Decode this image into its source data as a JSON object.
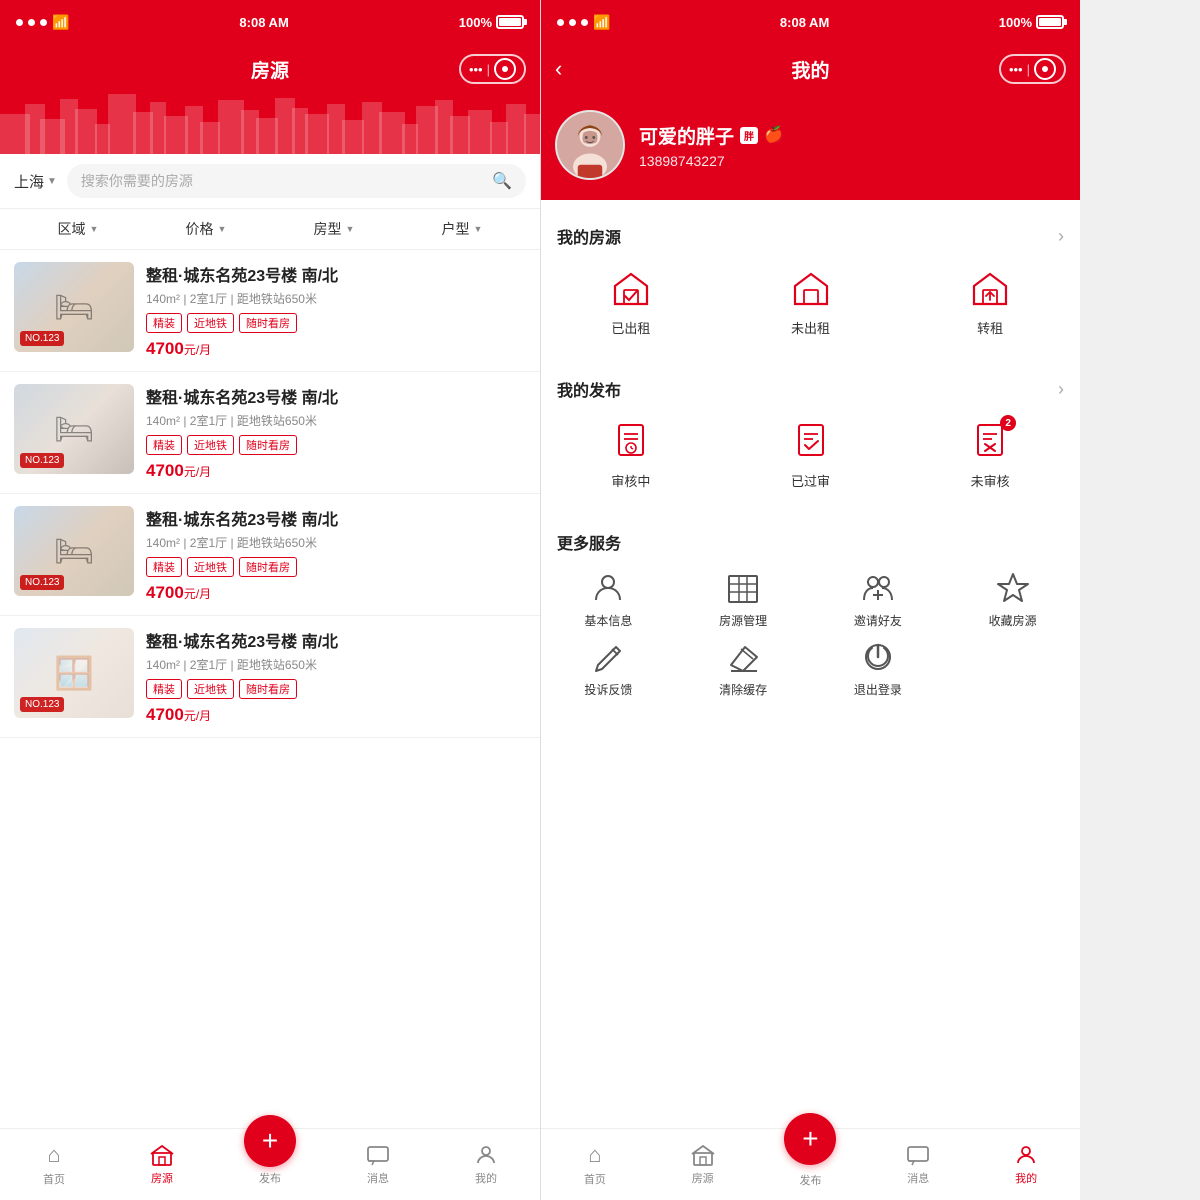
{
  "phones": [
    {
      "id": "left",
      "statusBar": {
        "time": "8:08 AM",
        "battery": "100%"
      },
      "header": {
        "title": "房源",
        "hasBack": false
      },
      "search": {
        "city": "上海",
        "placeholder": "搜索你需要的房源"
      },
      "filters": [
        {
          "label": "区域"
        },
        {
          "label": "价格"
        },
        {
          "label": "房型"
        },
        {
          "label": "户型"
        }
      ],
      "listings": [
        {
          "title": "整租·城东名苑23号楼  南/北",
          "meta": "140m² | 2室1厅 | 距地铁站650米",
          "tags": [
            "精装",
            "近地铁",
            "随时看房"
          ],
          "price": "4700",
          "unit": "元/月",
          "badge": "NO.123",
          "imgClass": "room-img-1",
          "imgIcon": "🛏"
        },
        {
          "title": "整租·城东名苑23号楼  南/北",
          "meta": "140m² | 2室1厅 | 距地铁站650米",
          "tags": [
            "精装",
            "近地铁",
            "随时看房"
          ],
          "price": "4700",
          "unit": "元/月",
          "badge": "NO.123",
          "imgClass": "room-img-2",
          "imgIcon": "🛏"
        },
        {
          "title": "整租·城东名苑23号楼  南/北",
          "meta": "140m² | 2室1厅 | 距地铁站650米",
          "tags": [
            "精装",
            "近地铁",
            "随时看房"
          ],
          "price": "4700",
          "unit": "元/月",
          "badge": "NO.123",
          "imgClass": "room-img-3",
          "imgIcon": "🛏"
        },
        {
          "title": "整租·城东名苑23号楼  南/北",
          "meta": "140m² | 2室1厅 | 距地铁站650米",
          "tags": [
            "精装",
            "近地铁",
            "随时看房"
          ],
          "price": "4700",
          "unit": "元/月",
          "badge": "NO.123",
          "imgClass": "room-img-4",
          "imgIcon": "🪟"
        }
      ],
      "nav": [
        {
          "label": "首页",
          "icon": "⌂",
          "active": false
        },
        {
          "label": "房源",
          "icon": "🏛",
          "active": true
        },
        {
          "label": "发布",
          "icon": "+",
          "isPlus": true
        },
        {
          "label": "消息",
          "icon": "💬",
          "active": false
        },
        {
          "label": "我的",
          "icon": "👤",
          "active": false
        }
      ]
    },
    {
      "id": "right",
      "statusBar": {
        "time": "8:08 AM",
        "battery": "100%"
      },
      "header": {
        "title": "我的",
        "hasBack": true
      },
      "profile": {
        "name": "可爱的胖子",
        "badge": "胖",
        "phone": "13898743227",
        "avatarEmoji": "👩"
      },
      "myListings": {
        "title": "我的房源",
        "items": [
          {
            "label": "已出租",
            "icon": "house-check"
          },
          {
            "label": "未出租",
            "icon": "house-empty"
          },
          {
            "label": "转租",
            "icon": "house-transfer"
          }
        ]
      },
      "myPublish": {
        "title": "我的发布",
        "items": [
          {
            "label": "审核中",
            "icon": "clock-check",
            "badge": null
          },
          {
            "label": "已过审",
            "icon": "doc-check",
            "badge": null
          },
          {
            "label": "未审核",
            "icon": "doc-x",
            "badge": "2"
          }
        ]
      },
      "moreServices": {
        "title": "更多服务",
        "items": [
          {
            "label": "基本信息",
            "icon": "person-icon"
          },
          {
            "label": "房源管理",
            "icon": "building-icon"
          },
          {
            "label": "邀请好友",
            "icon": "invite-icon"
          },
          {
            "label": "收藏房源",
            "icon": "star-icon"
          },
          {
            "label": "投诉反馈",
            "icon": "edit-icon"
          },
          {
            "label": "清除缓存",
            "icon": "eraser-icon"
          },
          {
            "label": "退出登录",
            "icon": "power-icon"
          }
        ]
      },
      "nav": [
        {
          "label": "首页",
          "icon": "⌂",
          "active": false
        },
        {
          "label": "房源",
          "icon": "🏛",
          "active": false
        },
        {
          "label": "发布",
          "icon": "+",
          "isPlus": true
        },
        {
          "label": "消息",
          "icon": "💬",
          "active": false
        },
        {
          "label": "我的",
          "icon": "👤",
          "active": true
        }
      ]
    }
  ]
}
